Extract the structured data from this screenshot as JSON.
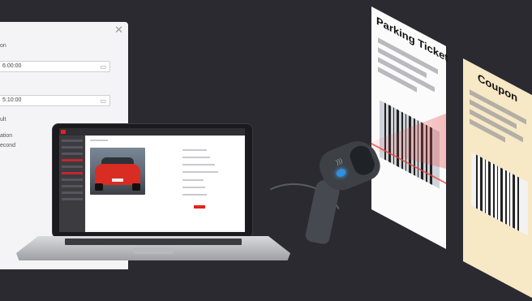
{
  "dialog": {
    "close_icon": "close-icon",
    "line_1": "on",
    "field_1_value": "6:00:00",
    "field_2_value": "5:10:00",
    "line_2": "ult",
    "line_3": "ation",
    "line_4": "econd",
    "calendar_icon": "calendar-icon"
  },
  "tickets": {
    "parking_title": "Parking Ticket",
    "coupon_title": "Coupon"
  },
  "colors": {
    "background": "#2a2a30",
    "accent_red": "#e2231a",
    "coupon": "#f7e8c6",
    "scanner_light": "#2f8fe0"
  }
}
